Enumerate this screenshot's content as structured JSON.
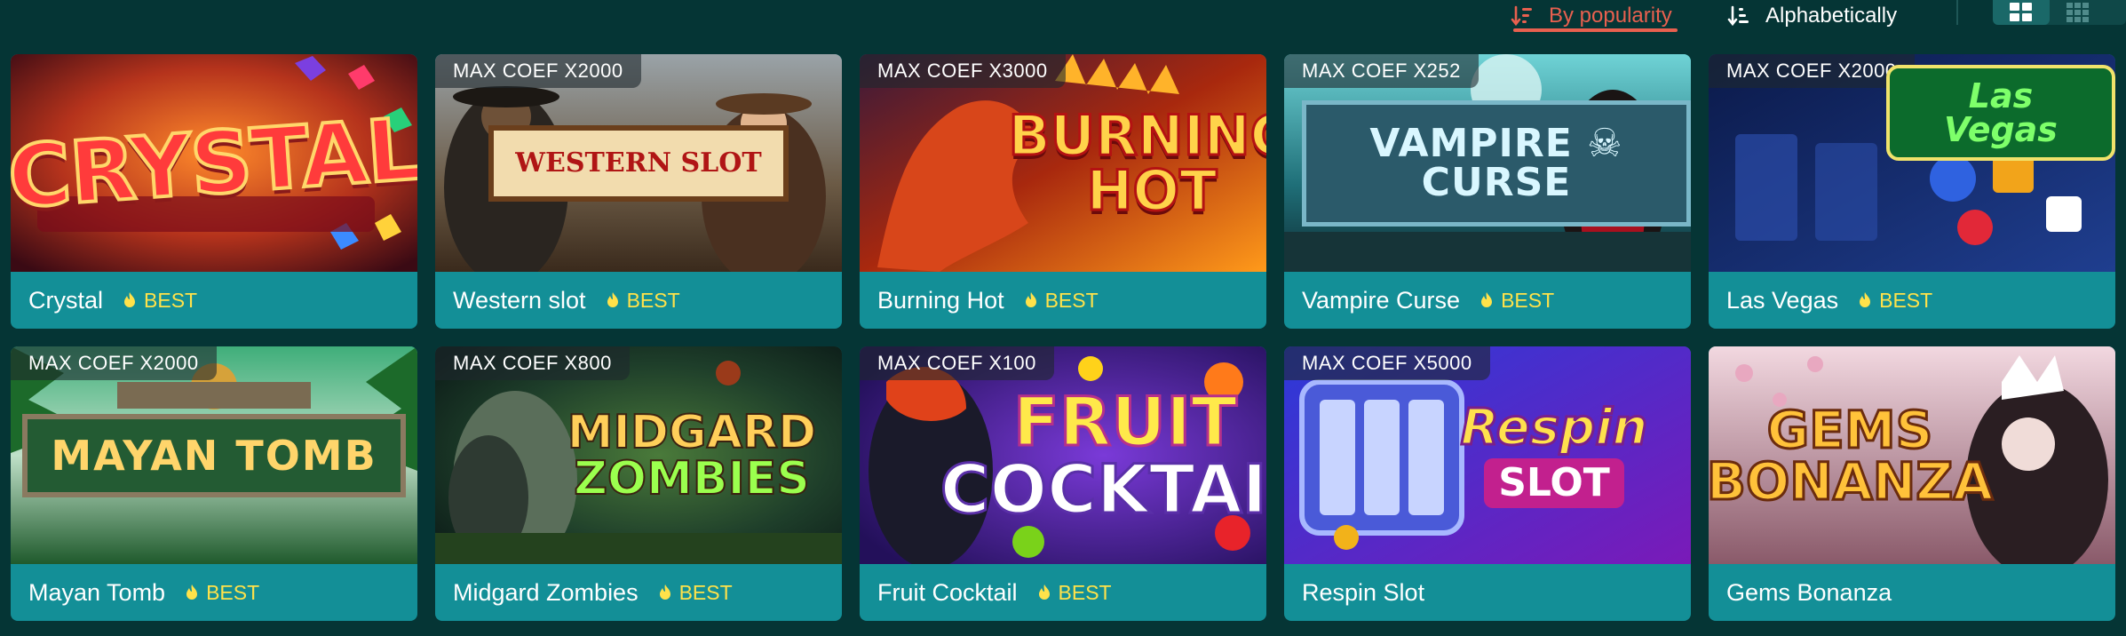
{
  "sorting": {
    "popularity_label": "By popularity",
    "alphabetical_label": "Alphabetically",
    "active": "popularity"
  },
  "view_toggle": {
    "active": "large-grid",
    "options": [
      "large-grid",
      "small-grid"
    ]
  },
  "best_label": "BEST",
  "colors": {
    "background": "#053535",
    "card_caption": "#138f97",
    "accent_active_sort": "#e8604f",
    "best_badge": "#ffe24a"
  },
  "games": [
    {
      "title": "Crystal",
      "badge": "",
      "best": true,
      "logo_text": [
        "CRYSTAL"
      ]
    },
    {
      "title": "Western slot",
      "badge": "MAX COEF X2000",
      "best": true,
      "logo_text": [
        "WESTERN SLOT"
      ]
    },
    {
      "title": "Burning Hot",
      "badge": "MAX COEF X3000",
      "best": true,
      "logo_text": [
        "BURNING",
        "HOT"
      ]
    },
    {
      "title": "Vampire Curse",
      "badge": "MAX COEF X252",
      "best": true,
      "logo_text": [
        "VAMPIRE ☠ CURSE"
      ]
    },
    {
      "title": "Las Vegas",
      "badge": "MAX COEF X2000",
      "best": true,
      "logo_text": [
        "Las Vegas"
      ]
    },
    {
      "title": "Mayan Tomb",
      "badge": "MAX COEF X2000",
      "best": true,
      "logo_text": [
        "MAYAN TOMB"
      ]
    },
    {
      "title": "Midgard Zombies",
      "badge": "MAX COEF X800",
      "best": true,
      "logo_text": [
        "MIDGARD",
        "ZOMBIES"
      ]
    },
    {
      "title": "Fruit Cocktail",
      "badge": "MAX COEF X100",
      "best": true,
      "logo_text": [
        "FRUIT",
        "COCKTAIL"
      ]
    },
    {
      "title": "Respin Slot",
      "badge": "MAX COEF X5000",
      "best": false,
      "logo_text": [
        "Respin",
        "SLOT"
      ]
    },
    {
      "title": "Gems Bonanza",
      "badge": "",
      "best": false,
      "logo_text": [
        "GEMS",
        "BONANZA"
      ]
    }
  ]
}
